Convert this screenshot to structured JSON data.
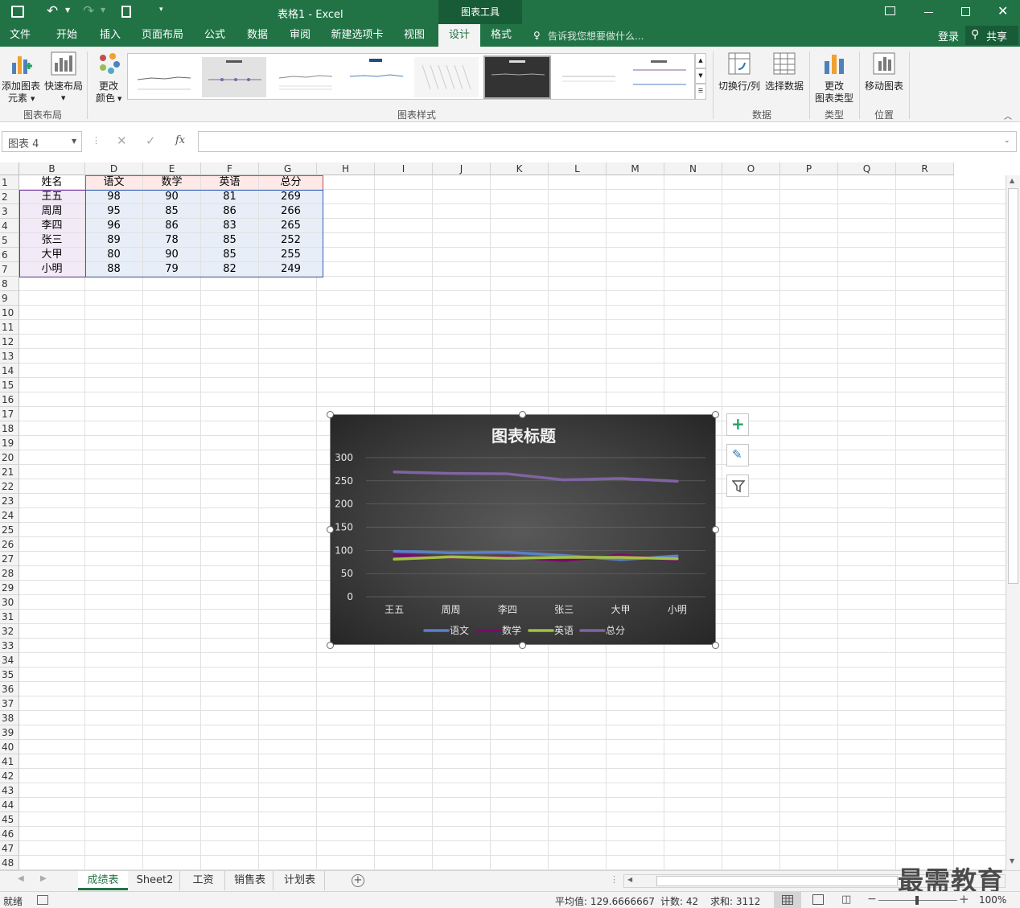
{
  "window": {
    "title": "表格1 - Excel",
    "context_tab": "图表工具",
    "login": "登录",
    "share": "共享"
  },
  "tabs": [
    {
      "label": "文件"
    },
    {
      "label": "开始"
    },
    {
      "label": "插入"
    },
    {
      "label": "页面布局"
    },
    {
      "label": "公式"
    },
    {
      "label": "数据"
    },
    {
      "label": "审阅"
    },
    {
      "label": "新建选项卡"
    },
    {
      "label": "视图"
    },
    {
      "label": "设计"
    },
    {
      "label": "格式"
    }
  ],
  "tell_me": "告诉我您想要做什么...",
  "ribbon": {
    "add_element": "添加图表\n元素",
    "add_element_l1": "添加图表",
    "add_element_l2": "元素",
    "quick_layout": "快速布局",
    "change_color_l1": "更改",
    "change_color_l2": "颜色",
    "group_layout": "图表布局",
    "group_styles": "图表样式",
    "switch_rowcol": "切换行/列",
    "select_data": "选择数据",
    "group_data": "数据",
    "change_type_l1": "更改",
    "change_type_l2": "图表类型",
    "group_type": "类型",
    "move_chart": "移动图表",
    "group_location": "位置"
  },
  "formula": {
    "name_box": "图表 4",
    "fx": "fx",
    "content": ""
  },
  "columns": [
    "B",
    "D",
    "E",
    "F",
    "G",
    "H",
    "I",
    "J",
    "K",
    "L",
    "M",
    "N",
    "O",
    "P",
    "Q",
    "R"
  ],
  "rows": [
    "1",
    "2",
    "3",
    "4",
    "5",
    "6",
    "7",
    "8",
    "9",
    "10",
    "11",
    "12",
    "13",
    "14",
    "15",
    "16",
    "17",
    "18",
    "19",
    "20",
    "21",
    "22",
    "23",
    "24",
    "25",
    "26",
    "27",
    "28",
    "29",
    "30",
    "31",
    "32",
    "33",
    "34",
    "35",
    "36",
    "37",
    "38",
    "39",
    "40",
    "41",
    "42",
    "43",
    "44",
    "45",
    "46",
    "47",
    "48"
  ],
  "table": {
    "headers": [
      "姓名",
      "语文",
      "数学",
      "英语",
      "总分"
    ],
    "rows": [
      [
        "王五",
        "98",
        "90",
        "81",
        "269"
      ],
      [
        "周周",
        "95",
        "85",
        "86",
        "266"
      ],
      [
        "李四",
        "96",
        "86",
        "83",
        "265"
      ],
      [
        "张三",
        "89",
        "78",
        "85",
        "252"
      ],
      [
        "大甲",
        "80",
        "90",
        "85",
        "255"
      ],
      [
        "小明",
        "88",
        "79",
        "82",
        "249"
      ]
    ]
  },
  "chart_data": {
    "type": "line",
    "title": "图表标题",
    "categories": [
      "王五",
      "周周",
      "李四",
      "张三",
      "大甲",
      "小明"
    ],
    "series": [
      {
        "name": "语文",
        "values": [
          98,
          95,
          96,
          89,
          80,
          88
        ],
        "color": "#5b7fc9"
      },
      {
        "name": "数学",
        "values": [
          90,
          85,
          86,
          78,
          90,
          79
        ],
        "color": "#7a0a6e"
      },
      {
        "name": "英语",
        "values": [
          81,
          86,
          83,
          85,
          85,
          82
        ],
        "color": "#a2c243"
      },
      {
        "name": "总分",
        "values": [
          269,
          266,
          265,
          252,
          255,
          249
        ],
        "color": "#8064a2"
      }
    ],
    "ylim": [
      0,
      300
    ],
    "yticks": [
      "0",
      "50",
      "100",
      "150",
      "200",
      "250",
      "300"
    ],
    "legend": "bottom",
    "grid": true
  },
  "sheet_tabs": [
    {
      "label": "成绩表"
    },
    {
      "label": "Sheet2"
    },
    {
      "label": "工资"
    },
    {
      "label": "销售表"
    },
    {
      "label": "计划表"
    }
  ],
  "status": {
    "ready": "就绪",
    "average": "平均值: 129.6666667",
    "count": "计数: 42",
    "sum": "求和: 3112",
    "zoom": "100%"
  },
  "watermark": "最需教育",
  "colors": {
    "accent": "#217346"
  }
}
